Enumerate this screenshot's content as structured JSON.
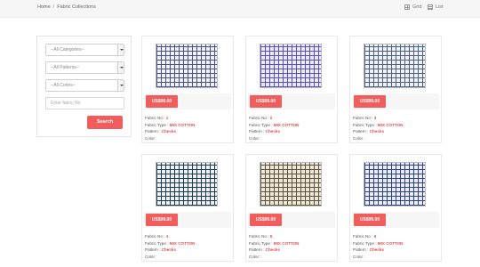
{
  "breadcrumb": {
    "home": "Home",
    "separator": "/",
    "current": "Fabric Collections"
  },
  "view_toggle": {
    "grid_label": "Grid",
    "list_label": "List"
  },
  "filters": {
    "categories": "--All Categories--",
    "patterns": "--All Patterns--",
    "colors": "--All Colors--",
    "fabric_no_placeholder": "Enter fabric No",
    "search_label": "Search"
  },
  "spec_labels": {
    "fabric_no": "Fabric No :",
    "fabric_type": "Fabric Type :",
    "pattern": "Pattern :",
    "color": "Color :"
  },
  "products": [
    {
      "price": "US$99.00",
      "fabric_no": "1",
      "fabric_type": "MIX COTTON",
      "pattern": "Checks",
      "color": "",
      "swatch_base": "#f2f2fa",
      "swatch_line": "#4a4e8a"
    },
    {
      "price": "US$99.00",
      "fabric_no": "2",
      "fabric_type": "MIX COTTON",
      "pattern": "Checks",
      "color": "",
      "swatch_base": "#ecebfb",
      "swatch_line": "#5a4fc0"
    },
    {
      "price": "US$99.00",
      "fabric_no": "3",
      "fabric_type": "MIX COTTON",
      "pattern": "Checks",
      "color": "",
      "swatch_base": "#f0f3f8",
      "swatch_line": "#4d5e86"
    },
    {
      "price": "US$99.00",
      "fabric_no": "4",
      "fabric_type": "MIX COTTON",
      "pattern": "Checks",
      "color": "",
      "swatch_base": "#eef2f5",
      "swatch_line": "#1e3a4f"
    },
    {
      "price": "US$99.00",
      "fabric_no": "5",
      "fabric_type": "MIX COTTON",
      "pattern": "Checks",
      "color": "",
      "swatch_base": "#efe8d6",
      "swatch_line": "#5b5140"
    },
    {
      "price": "US$99.00",
      "fabric_no": "6",
      "fabric_type": "MIX COTTON",
      "pattern": "Checks",
      "color": "",
      "swatch_base": "#eceef8",
      "swatch_line": "#2e3f92"
    }
  ]
}
